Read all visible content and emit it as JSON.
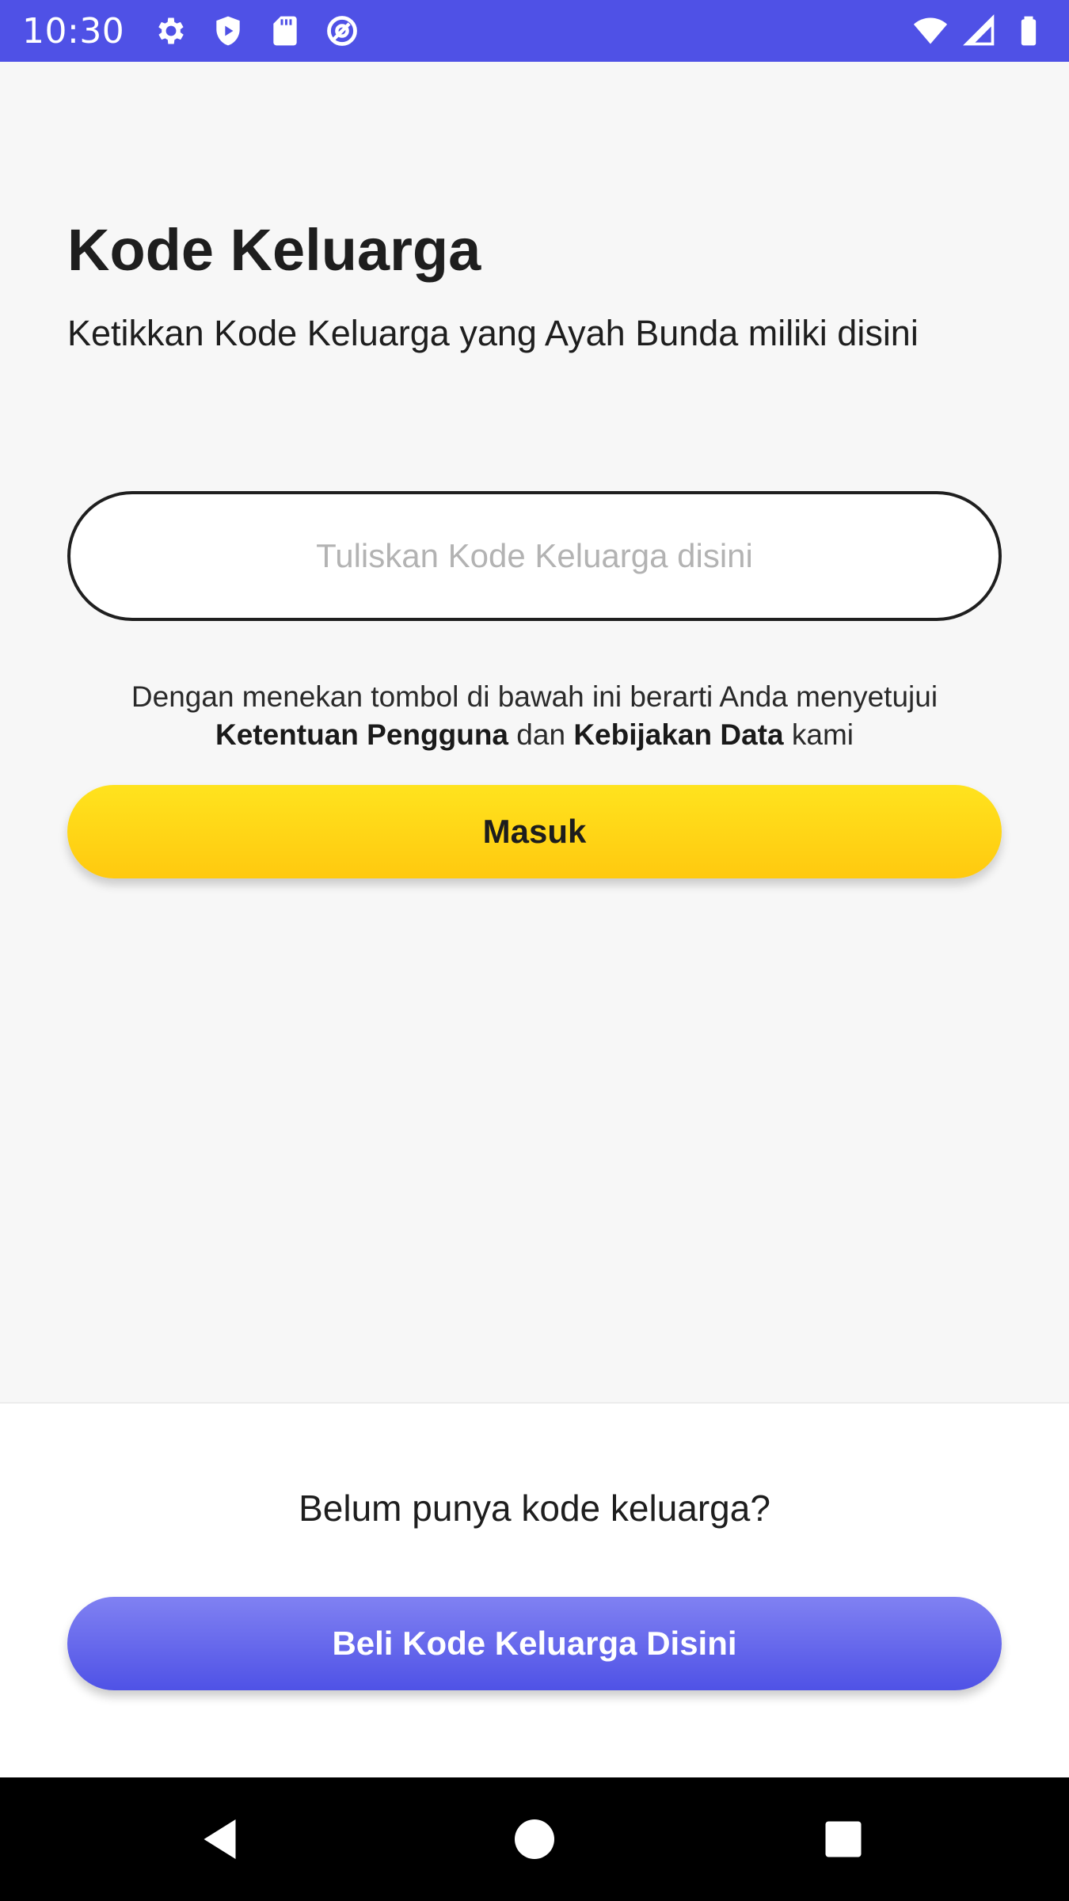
{
  "status_bar": {
    "time": "10:30",
    "left_icons": [
      "settings-icon",
      "shield-play-icon",
      "sd-card-icon",
      "at-sign-icon"
    ],
    "right_icons": [
      "wifi-icon",
      "signal-icon",
      "battery-icon"
    ],
    "background": "#4f51e6"
  },
  "header": {
    "title": "Kode Keluarga",
    "subtitle": "Ketikkan Kode Keluarga yang Ayah Bunda miliki disini"
  },
  "form": {
    "code_value": "",
    "code_placeholder": "Tuliskan Kode Keluarga disini",
    "terms_prefix": "Dengan menekan tombol di bawah ini berarti Anda menyetujui ",
    "terms_link": "Ketentuan Pengguna",
    "terms_middle": " dan ",
    "policy_link": "Kebijakan Data",
    "terms_suffix": " kami",
    "submit_label": "Masuk",
    "submit_color": "#ffd616"
  },
  "bottom": {
    "question": "Belum punya kode keluarga?",
    "buy_label": "Beli Kode Keluarga Disini",
    "buy_color": "#5b5de9"
  },
  "nav_bar": {
    "buttons": [
      "back-icon",
      "home-icon",
      "recents-icon"
    ]
  }
}
